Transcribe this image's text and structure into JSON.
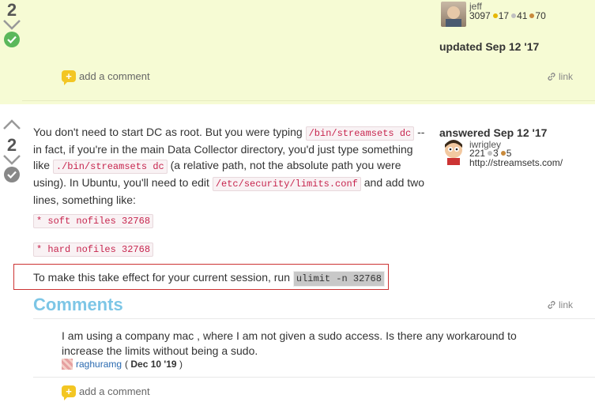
{
  "top_answer": {
    "vote_count": "2",
    "user": {
      "name": "jeff",
      "rep": "3097",
      "gold": "17",
      "silver": "41",
      "bronze": "70"
    },
    "timestamp": "updated Sep 12 '17",
    "add_comment": "add a comment",
    "link": "link"
  },
  "answer": {
    "vote_count": "2",
    "timestamp": "answered Sep 12 '17",
    "user": {
      "name": "iwrigley",
      "rep": "221",
      "silver": "3",
      "bronze": "5",
      "website": "http://streamsets.com/"
    },
    "p1_a": "You don't need to start DC as root. But you were typing ",
    "code1": "/bin/streamsets dc",
    "p1_b": " -- in fact, if you're in the main Data Collector directory, you'd just type something like ",
    "code2": "./bin/streamsets dc",
    "p1_c": " (a relative path, not the absolute path you were using). In Ubuntu, you'll need to edit ",
    "code3": "/etc/security/limits.conf",
    "p1_d": " and add two lines, something like:",
    "line1": "* soft nofiles 32768",
    "line2": "* hard nofiles 32768",
    "session_text": "To make this take effect for your current session, run ",
    "session_cmd": "ulimit -n 32768"
  },
  "comments": {
    "title": "Comments",
    "link": "link",
    "items": [
      {
        "text": "I am using a company mac , where I am not given a sudo access. Is there any workaround to increase the limits without being a sudo.",
        "author": "raghuramg",
        "date": "Dec 10 '19"
      }
    ],
    "add_comment": "add a comment"
  }
}
